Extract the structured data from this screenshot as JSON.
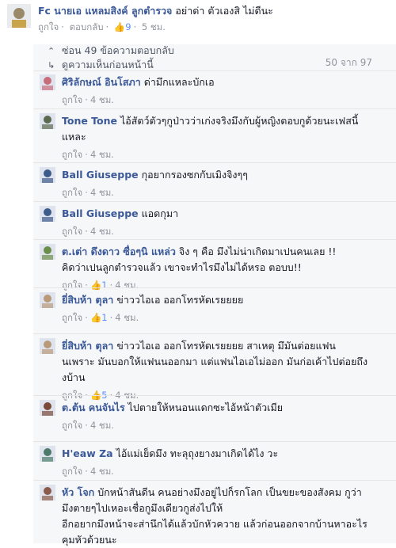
{
  "top_comment": {
    "name": "Fc นายเอ แหลมสิงค์ ลูกตำรวจ",
    "text": "อย่าด่า ตัวเองสิ ไม่ดีนะ",
    "like": "ถูกใจ",
    "reply": "ตอบกลับ",
    "likes": "9",
    "time": "5 ชม."
  },
  "thread": {
    "hide_label": "ซ่อน 49 ข้อความตอบกลับ",
    "prev_label": "ดูความเห็นก่อนหน้านี้",
    "pager": "50 จาก 97"
  },
  "replies": [
    {
      "name": "ศิริลักษณ์ อินโสภา",
      "text": "ด่ามึกแหละบักเอ",
      "like": "ถูกใจ",
      "likes": "",
      "time": "4 ชม.",
      "avatar_color": "#c96c7a"
    },
    {
      "name": "Tone Tone",
      "text": "ไอ้สัตว์ตัวๆกูป่าวว่าเก่งจริงมึงกับผู้หญิงตอบกูด้วยนะเฟสนี้",
      "text2": "แหละ",
      "like": "ถูกใจ",
      "likes": "",
      "time": "4 ชม.",
      "avatar_color": "#5b6a4e"
    },
    {
      "name": "Ball Giuseppe",
      "text": "กุอยากรองซกกับเมิงจิงๆๆ",
      "like": "ถูกใจ",
      "likes": "",
      "time": "4 ชม.",
      "avatar_color": "#3c5a8a"
    },
    {
      "name": "Ball Giuseppe",
      "text": "แอดกุมา",
      "like": "ถูกใจ",
      "likes": "",
      "time": "4 ชม.",
      "avatar_color": "#3c5a8a"
    },
    {
      "name": "ต.เต่า ดึงดาว ซื่อๆนิ แหล่ว",
      "text": "จิง ๆ คือ มึงไม่น่าเกิดมาเปนคนเลย !!",
      "text2": "คิดว่าเปนลูกตำรวจแล้ว เขาจะทำไรมึงไม่ได้หรอ ตอบบ!!",
      "like": "ถูกใจ",
      "likes": "1",
      "time": "4 ชม.",
      "avatar_color": "#6b8f4a"
    },
    {
      "name": "ยี่สิบห้า ตุลา",
      "text": "ข่าววไอเอ ออกโทรหัดเรยยยย",
      "like": "ถูกใจ",
      "likes": "1",
      "time": "4 ชม.",
      "avatar_color": "#b89a7a"
    },
    {
      "name": "ยี่สิบห้า ตุลา",
      "text": "ข่าววไอเอ ออกโทรหัดเรยยยย สาเหตุ มึมันต่อยแฟน",
      "text2": "นเพราะ มันบอกให้แฟนนออกมา แต่แฟนไอเอไม่ออก มันก่อเค้าไปต่อยถึง",
      "text3": "งบ้าน",
      "like": "ถูกใจ",
      "likes": "5",
      "time": "4 ชม.",
      "avatar_color": "#b89a7a"
    },
    {
      "name": "ต.ต้น คนจันไร",
      "text": "ไปตายให้หนอนแดกซะไอ้หน้าตัวเมีย",
      "like": "ถูกใจ",
      "likes": "",
      "time": "4 ชม.",
      "avatar_color": "#7a4a3a"
    },
    {
      "name": "H'eaw Za",
      "text": "ไอ้แม่เย็ดมึง ทะลุถุงยางมาเกิดได้ไง วะ",
      "like": "ถูกใจ",
      "likes": "",
      "time": "4 ชม.",
      "avatar_color": "#4a7a6a"
    },
    {
      "name": "หัว โจก",
      "text": "บักหน้าสันดีน คนอย่างมึงอยู่ไปก็รกโลก เป็นขยะของสังคม กูว่า",
      "text2": "มึงตายๆไปเหอะเชื่อกูมึงเดียวกูส่งไปให้",
      "text3": "อีกอยากมึงหน้าจะส่านึกได้แล้วบักหัวควาย แล้วก่อนออกจากบ้านหาอะไร",
      "text4": "คุมหัวด้วยนะ",
      "like": "ถูกใจ",
      "likes": "",
      "time": "",
      "avatar_color": "#8a5a4a"
    }
  ]
}
